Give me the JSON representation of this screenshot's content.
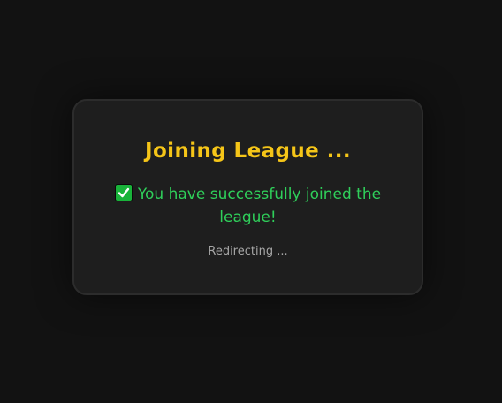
{
  "dialog": {
    "title": "Joining League ...",
    "success_message": "You have successfully joined the league!",
    "status": "Redirecting ..."
  },
  "icons": {
    "success": "check-mark-button-icon"
  },
  "colors": {
    "background": "#121212",
    "card": "#1e1e1e",
    "title": "#f5c518",
    "success": "#2fcf5a",
    "status": "#a6a6a6"
  }
}
